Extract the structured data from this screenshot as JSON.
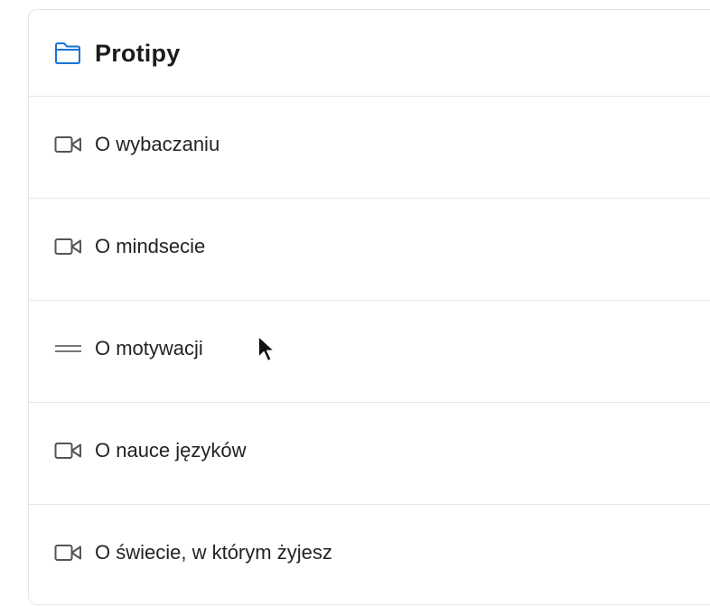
{
  "folder": {
    "title": "Protipy",
    "icon": "folder-icon",
    "accent_color": "#1a73d9"
  },
  "items": [
    {
      "label": "O wybaczaniu",
      "icon": "video-icon"
    },
    {
      "label": "O mindsecie",
      "icon": "video-icon"
    },
    {
      "label": "O motywacji",
      "icon": "text-lines-icon"
    },
    {
      "label": "O nauce języków",
      "icon": "video-icon"
    },
    {
      "label": "O świecie, w którym żyjesz",
      "icon": "video-icon"
    }
  ]
}
